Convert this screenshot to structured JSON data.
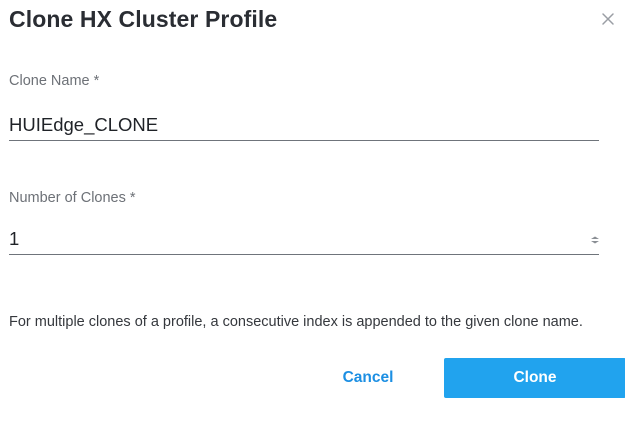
{
  "dialog": {
    "title": "Clone HX Cluster Profile",
    "close_icon": "close-icon"
  },
  "clone_name": {
    "label": "Clone Name *",
    "value": "HUIEdge_CLONE"
  },
  "number_of_clones": {
    "label": "Number of Clones *",
    "value": "1",
    "stepper_icon": "stepper-arrows-icon"
  },
  "help_text": "For multiple clones of a profile, a consecutive index is appended to the given clone name.",
  "actions": {
    "cancel_label": "Cancel",
    "clone_label": "Clone"
  },
  "colors": {
    "accent": "#21a3ee",
    "link": "#1c8fe3",
    "underline": "#6f747b",
    "label": "#6d7177"
  }
}
